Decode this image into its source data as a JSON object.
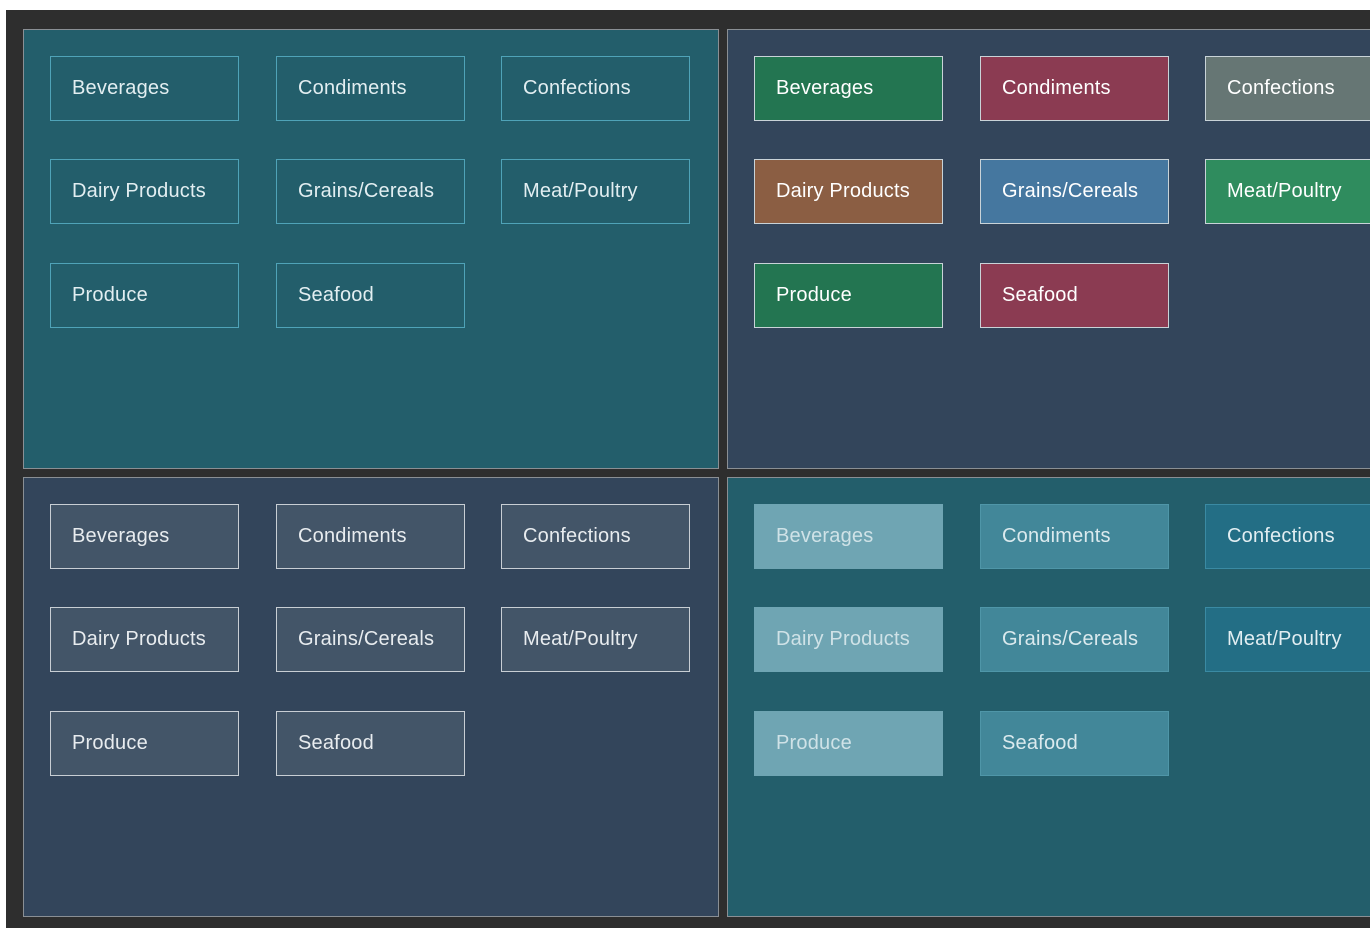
{
  "categories": [
    "Beverages",
    "Condiments",
    "Confections",
    "Dairy Products",
    "Grains/Cereals",
    "Meat/Poultry",
    "Produce",
    "Seafood"
  ],
  "panels": [
    {
      "background": "#235e6b",
      "tiles": [
        {
          "bg": "transparent",
          "border": "#4fa3b8",
          "text": "#e2eef1"
        },
        {
          "bg": "transparent",
          "border": "#4fa3b8",
          "text": "#e2eef1"
        },
        {
          "bg": "transparent",
          "border": "#4fa3b8",
          "text": "#e2eef1"
        },
        {
          "bg": "transparent",
          "border": "#4fa3b8",
          "text": "#e2eef1"
        },
        {
          "bg": "transparent",
          "border": "#4fa3b8",
          "text": "#e2eef1"
        },
        {
          "bg": "transparent",
          "border": "#4fa3b8",
          "text": "#e2eef1"
        },
        {
          "bg": "transparent",
          "border": "#4fa3b8",
          "text": "#e2eef1"
        },
        {
          "bg": "transparent",
          "border": "#4fa3b8",
          "text": "#e2eef1"
        }
      ]
    },
    {
      "background": "#33455b",
      "tiles": [
        {
          "bg": "#237551",
          "border": "#c9d3d8",
          "text": "#ffffff"
        },
        {
          "bg": "#8b3b52",
          "border": "#c9d3d8",
          "text": "#ffffff"
        },
        {
          "bg": "#667674",
          "border": "#c9d3d8",
          "text": "#ffffff"
        },
        {
          "bg": "#8b5e43",
          "border": "#c9d3d8",
          "text": "#ffffff"
        },
        {
          "bg": "#45779f",
          "border": "#c9d3d8",
          "text": "#ffffff"
        },
        {
          "bg": "#2f8c5e",
          "border": "#c9d3d8",
          "text": "#ffffff"
        },
        {
          "bg": "#237551",
          "border": "#c9d3d8",
          "text": "#ffffff"
        },
        {
          "bg": "#8b3b52",
          "border": "#c9d3d8",
          "text": "#ffffff"
        }
      ]
    },
    {
      "background": "#33455b",
      "tiles": [
        {
          "bg": "#435568",
          "border": "#c8ced4",
          "text": "#e8ecef"
        },
        {
          "bg": "#435568",
          "border": "#c8ced4",
          "text": "#e8ecef"
        },
        {
          "bg": "#435568",
          "border": "#c8ced4",
          "text": "#e8ecef"
        },
        {
          "bg": "#435568",
          "border": "#c8ced4",
          "text": "#e8ecef"
        },
        {
          "bg": "#435568",
          "border": "#c8ced4",
          "text": "#e8ecef"
        },
        {
          "bg": "#435568",
          "border": "#c8ced4",
          "text": "#e8ecef"
        },
        {
          "bg": "#435568",
          "border": "#c8ced4",
          "text": "#e8ecef"
        },
        {
          "bg": "#435568",
          "border": "#c8ced4",
          "text": "#e8ecef"
        }
      ]
    },
    {
      "background": "#235e6b",
      "tiles": [
        {
          "bg": "#6fa5b3",
          "border": "#6fa5b3",
          "text": "#cfe2e7"
        },
        {
          "bg": "#428799",
          "border": "#4f96a8",
          "text": "#dbeaee"
        },
        {
          "bg": "#236e85",
          "border": "#3a8aa3",
          "text": "#e2eef2"
        },
        {
          "bg": "#6fa5b3",
          "border": "#6fa5b3",
          "text": "#cfe2e7"
        },
        {
          "bg": "#428799",
          "border": "#4f96a8",
          "text": "#dbeaee"
        },
        {
          "bg": "#236e85",
          "border": "#3a8aa3",
          "text": "#e2eef2"
        },
        {
          "bg": "#6fa5b3",
          "border": "#6fa5b3",
          "text": "#cfe2e7"
        },
        {
          "bg": "#428799",
          "border": "#4f96a8",
          "text": "#dbeaee"
        }
      ]
    }
  ]
}
